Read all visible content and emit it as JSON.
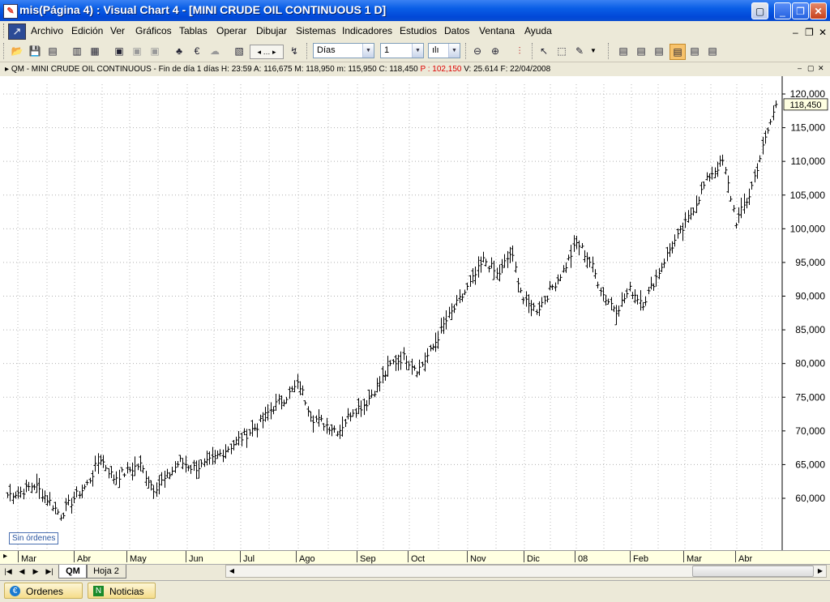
{
  "window": {
    "title": "mis(Página 4) : Visual Chart 4 - [MINI CRUDE OIL CONTINUOUS 1 D]"
  },
  "menu": {
    "items": [
      "Archivo",
      "Edición",
      "Ver",
      "Gráficos",
      "Tablas",
      "Operar",
      "Dibujar",
      "Sistemas",
      "Indicadores",
      "Estudios",
      "Datos",
      "Ventana",
      "Ayuda"
    ]
  },
  "toolbar": {
    "period_value": "Días",
    "multiplier_value": "1"
  },
  "info_bar": {
    "text": "QM - MINI CRUDE OIL CONTINUOUS - Fin de día 1 días H: 23:59  A: 116,675  M: 118,950  m: 115,950  C: 118,450",
    "p_text": "P : 102,150",
    "tail_text": "V: 25.614  F: 22/04/2008"
  },
  "chart": {
    "orders_label": "Sin órdenes",
    "last_price_label": "118,450",
    "accent_color": "#ffffe1",
    "up_color": "#000000"
  },
  "chart_data": {
    "type": "bar",
    "title": "QM - MINI CRUDE OIL CONTINUOUS",
    "y_ticks": [
      "120,000",
      "115,000",
      "110,000",
      "105,000",
      "100,000",
      "95,000",
      "90,000",
      "85,000",
      "80,000",
      "75,000",
      "70,000",
      "65,000",
      "60,000"
    ],
    "ylim": [
      55000,
      121500
    ],
    "x_month_labels": [
      "Mar",
      "Abr",
      "May",
      "Jun",
      "Jul",
      "Ago",
      "Sep",
      "Oct",
      "Nov",
      "Dic",
      "08",
      "Feb",
      "Mar",
      "Abr"
    ],
    "close_anchors": [
      {
        "month": "Mar",
        "values": [
          60500,
          61000,
          62000,
          60000,
          57500,
          60000
        ]
      },
      {
        "month": "Abr",
        "values": [
          62000,
          66000,
          63000,
          64000,
          65000
        ]
      },
      {
        "month": "May",
        "values": [
          61500,
          63000,
          65500,
          64500
        ]
      },
      {
        "month": "Jun",
        "values": [
          65000,
          66500,
          68000,
          69500
        ]
      },
      {
        "month": "Jul",
        "values": [
          71000,
          73500,
          75000,
          77000
        ]
      },
      {
        "month": "Ago",
        "values": [
          72000,
          71000,
          70000,
          73000
        ]
      },
      {
        "month": "Sep",
        "values": [
          74000,
          77000,
          80000,
          81000
        ]
      },
      {
        "month": "Oct",
        "values": [
          79000,
          82000,
          86000,
          89000
        ]
      },
      {
        "month": "Nov",
        "values": [
          92000,
          95500,
          93000,
          96500
        ]
      },
      {
        "month": "Dic",
        "values": [
          89000,
          88000,
          91000,
          94000
        ]
      },
      {
        "month": "08",
        "values": [
          98000,
          95000,
          90000,
          88000
        ]
      },
      {
        "month": "Feb",
        "values": [
          91000,
          89000,
          93000,
          97000
        ]
      },
      {
        "month": "Mar",
        "values": [
          100000,
          104000,
          108000,
          110000
        ]
      },
      {
        "month": "Abr",
        "values": [
          101000,
          105000,
          112000,
          118450
        ]
      }
    ],
    "last_close": 118450,
    "grid": true
  },
  "tabs": {
    "sheets": [
      "QM",
      "Hoja 2"
    ],
    "bottom": [
      "Ordenes",
      "Noticias"
    ]
  }
}
